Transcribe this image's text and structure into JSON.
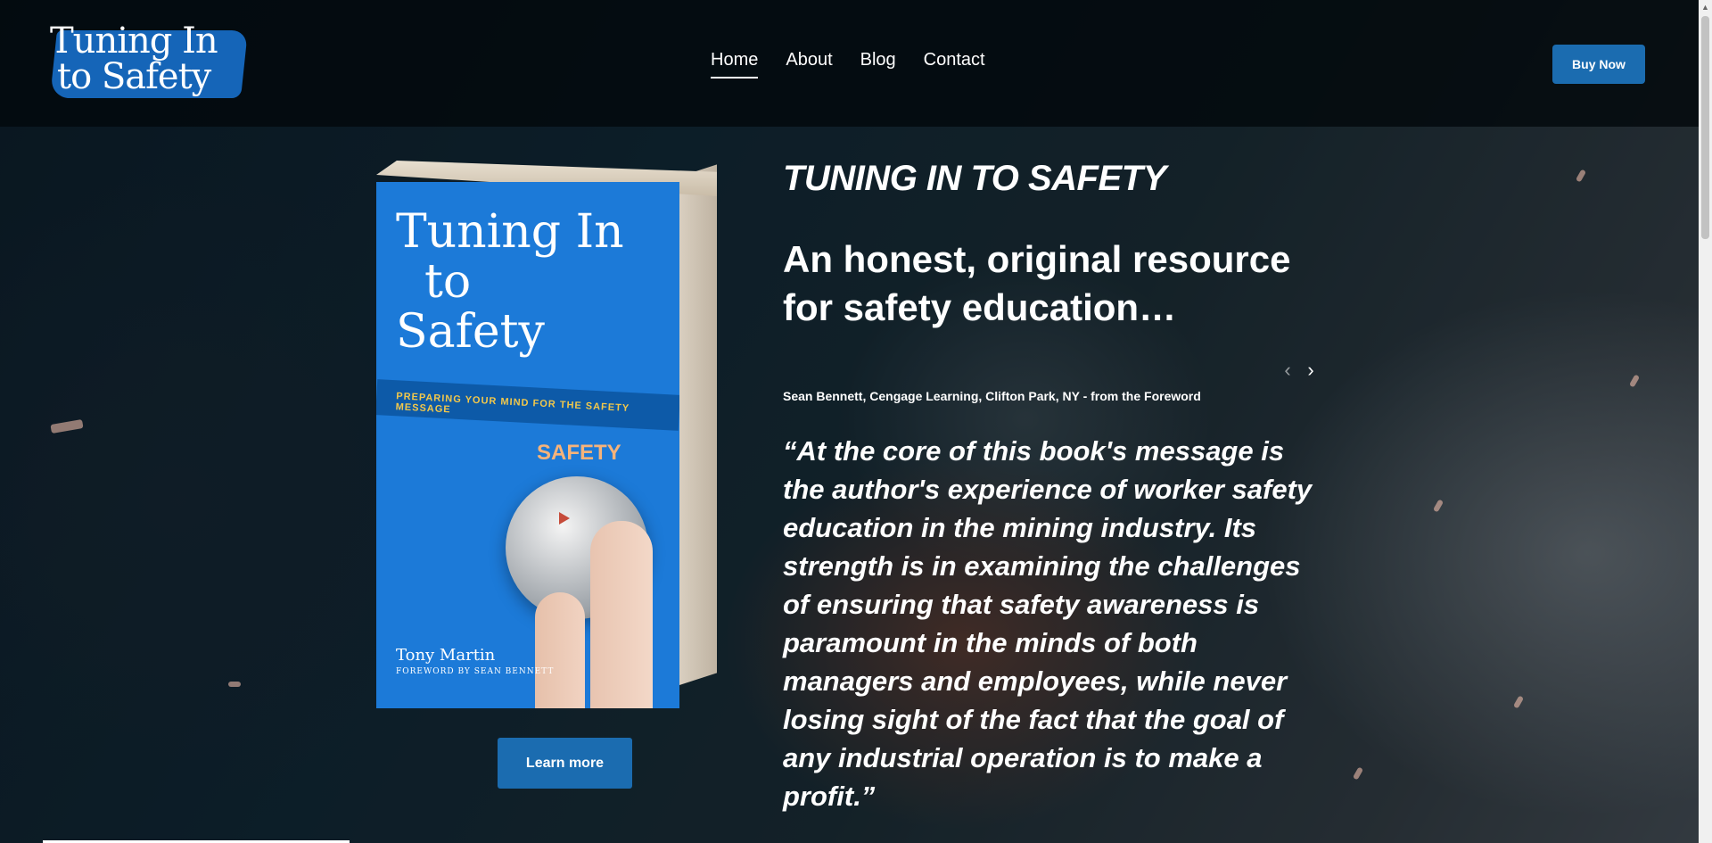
{
  "site": {
    "logo_line1": "Tuning In",
    "logo_line2": "to Safety"
  },
  "nav": {
    "items": [
      {
        "label": "Home",
        "active": true
      },
      {
        "label": "About",
        "active": false
      },
      {
        "label": "Blog",
        "active": false
      },
      {
        "label": "Contact",
        "active": false
      }
    ],
    "buy_label": "Buy Now"
  },
  "hero": {
    "book_cover": {
      "title_line1": "Tuning In",
      "title_line2": "to",
      "title_line3": "Safety",
      "subtitle": "PREPARING YOUR MIND FOR THE SAFETY MESSAGE",
      "dial_label": "SAFETY",
      "author": "Tony Martin",
      "foreword": "FOREWORD BY SEAN BENNETT"
    },
    "learn_more_label": "Learn more",
    "eyebrow": "TUNING IN TO SAFETY",
    "headline": "An honest, original resource for safety education…",
    "slider": {
      "prev_icon": "chevron-left-icon",
      "next_icon": "chevron-right-icon"
    },
    "attribution": "Sean Bennett, Cengage Learning, Clifton Park, NY - from the Foreword",
    "quote": "“At the core of this book's message is the author's experience of worker safety education in the mining industry. Its strength is in examining the challenges of ensuring that safety awareness is paramount in the minds of both managers and employees, while never losing sight of the fact that the goal of any industrial operation is to make a profit.”"
  },
  "colors": {
    "accent": "#1b6cb0",
    "book_blue": "#1c7ad8",
    "header_bg": "#03080c"
  }
}
